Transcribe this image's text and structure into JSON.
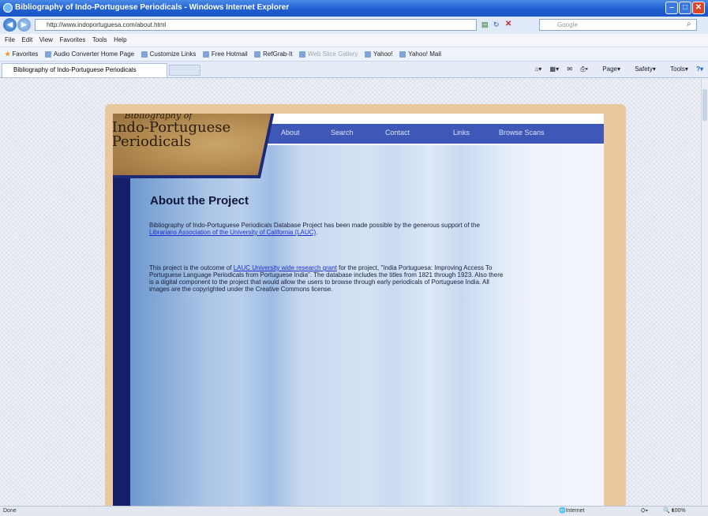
{
  "window": {
    "title": "Bibliography of Indo-Portuguese Periodicals - Windows Internet Explorer"
  },
  "address": {
    "url": "http://www.indoportuguesa.com/about.html",
    "search_placeholder": "Google"
  },
  "menu": [
    "File",
    "Edit",
    "View",
    "Favorites",
    "Tools",
    "Help"
  ],
  "favorites": {
    "label": "Favorites",
    "items": [
      "Audio Converter Home Page",
      "Customize Links",
      "Free Hotmail",
      "RefGrab-It",
      "Web Slice Gallery",
      "Yahoo!",
      "Yahoo! Mail"
    ]
  },
  "tab": {
    "title": "Bibliography of Indo-Portuguese Periodicals"
  },
  "commandbar": [
    "Page",
    "Safety",
    "Tools"
  ],
  "site": {
    "logo": {
      "line1": "Bibliography of",
      "line2": "Indo-Portuguese",
      "line3": "Periodicals"
    },
    "nav": [
      "About",
      "Search",
      "Contact",
      "Links",
      "Browse Scans"
    ],
    "heading": "About the Project",
    "p1_before": "Bibliography of Indo-Portuguese Periodicals Database Project has been made possible by the generous support of the ",
    "p1_link": "Librarians Association of the University of California (LAUC)",
    "p1_after": ".",
    "p2_before": "This project is the outcome of ",
    "p2_link": "LAUC University wide research grant",
    "p2_after": " for the project, \"India Portuguesa: Improving Access To Portuguese Language Periodicals from Portuguese India\". The database includes the titles from 1821 through 1923. Also there is a digital component to the project that would allow the users to browse through early periodicals of Portuguese India. All images are the copyrighted under the Creative Commons license."
  },
  "status": {
    "left": "Done",
    "zone": "Internet",
    "zoom": "100%"
  }
}
